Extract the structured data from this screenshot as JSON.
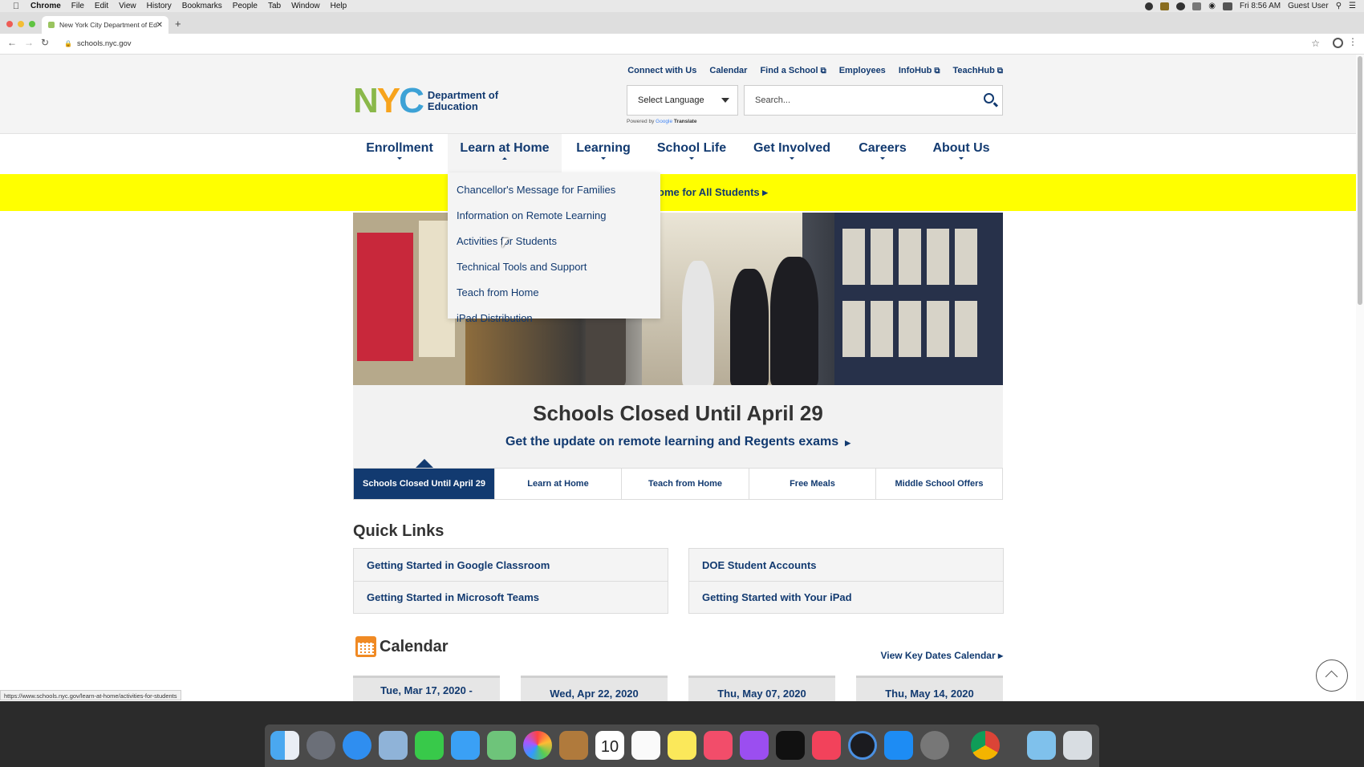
{
  "menubar": {
    "app": "Chrome",
    "items": [
      "File",
      "Edit",
      "View",
      "History",
      "Bookmarks",
      "People",
      "Tab",
      "Window",
      "Help"
    ],
    "clock": "Fri 8:56 AM",
    "user": "Guest User"
  },
  "browser": {
    "tab_title": "New York City Department of Ed",
    "url": "schools.nyc.gov",
    "status_url": "https://www.schools.nyc.gov/learn-at-home/activities-for-students"
  },
  "header": {
    "logo_letters": "NYC",
    "logo_text_line1": "Department of",
    "logo_text_line2": "Education",
    "utility_links": [
      "Connect with Us",
      "Calendar",
      "Find a School",
      "Employees",
      "InfoHub",
      "TeachHub"
    ],
    "language_select": "Select Language",
    "powered_by": "Powered by",
    "google": "Google",
    "translate": "Translate",
    "search_placeholder": "Search..."
  },
  "nav": {
    "items": [
      "Enrollment",
      "Learn at Home",
      "Learning",
      "School Life",
      "Get Involved",
      "Careers",
      "About Us"
    ],
    "active_index": 1
  },
  "dropdown": {
    "items": [
      "Chancellor's Message for Families",
      "Information on Remote Learning",
      "Activities for Students",
      "Technical Tools and Support",
      "Teach from Home",
      "iPad Distribution"
    ]
  },
  "banner": {
    "text": "ome for All Students ▸"
  },
  "hero": {
    "title": "Schools Closed Until April 29",
    "subtitle": "Get the update on remote learning and Regents exams",
    "tabs": [
      "Schools Closed Until April 29",
      "Learn at Home",
      "Teach from Home",
      "Free Meals",
      "Middle School Offers"
    ],
    "active_tab": 0
  },
  "quick_links": {
    "title": "Quick Links",
    "left": [
      "Getting Started in Google Classroom",
      "Getting Started in Microsoft Teams"
    ],
    "right": [
      "DOE Student Accounts",
      "Getting Started with Your iPad"
    ]
  },
  "calendar": {
    "title": "Calendar",
    "view_link": "View Key Dates Calendar ▸",
    "cards": [
      "Tue, Mar 17, 2020 -",
      "Wed, Apr 22, 2020",
      "Thu, May 07, 2020",
      "Thu, May 14, 2020"
    ]
  },
  "dock": {
    "icons": [
      "finder-icon",
      "launchpad-icon",
      "safari-icon",
      "preview-icon",
      "facetime-icon",
      "messages-icon",
      "maps-icon",
      "photos-icon",
      "notes-book-icon",
      "calendar-app-icon",
      "reminders-icon",
      "stickies-icon",
      "music-icon",
      "podcasts-icon",
      "apple-tv-icon",
      "news-icon",
      "quicktime-icon",
      "app-store-icon",
      "system-preferences-icon",
      "chrome-icon",
      "downloads-folder-icon",
      "trash-icon"
    ],
    "calendar_day": "10"
  },
  "colors": {
    "brand_blue": "#123a70",
    "banner_yellow": "#ffff00",
    "logo_green": "#8ab84a",
    "logo_orange": "#f7a31c",
    "logo_blue": "#3da2d6"
  }
}
